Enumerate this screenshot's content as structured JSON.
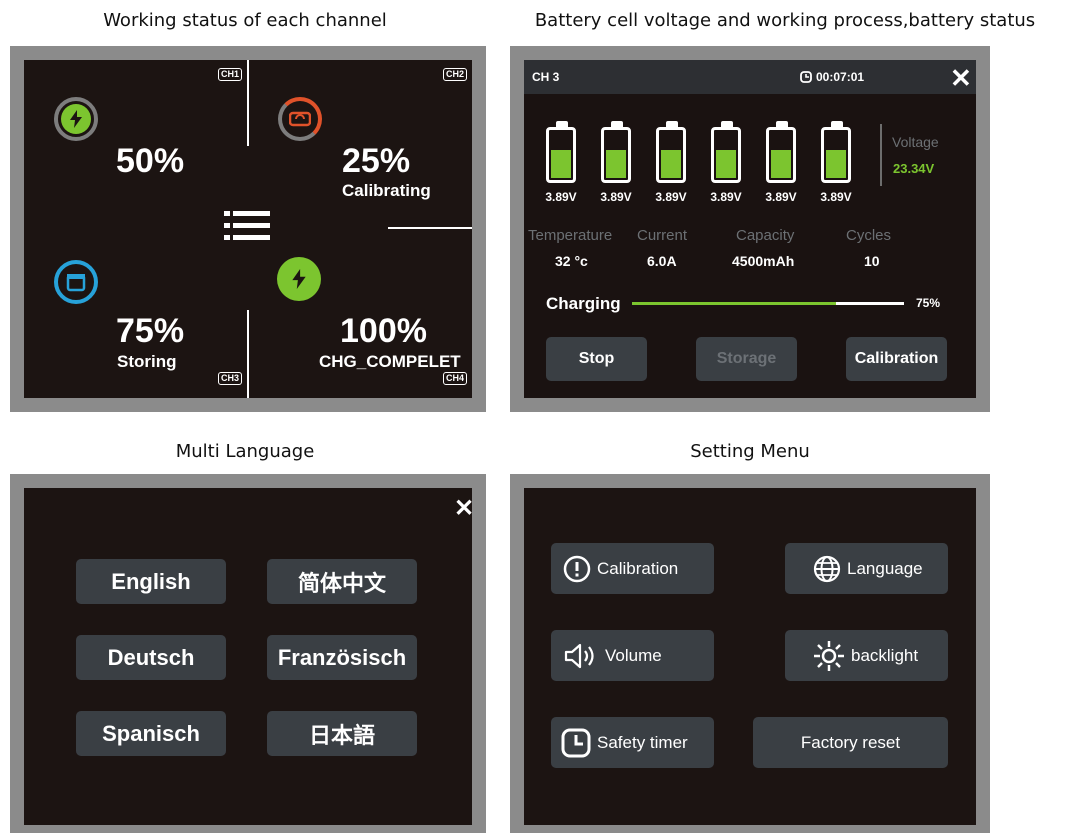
{
  "captions": {
    "channels": "Working status of each channel",
    "battery": "Battery cell voltage and working process,battery status",
    "language": "Multi Language",
    "settings": "Setting Menu"
  },
  "channels_screen": {
    "ch1": {
      "tag": "CH1",
      "percent": "50%",
      "status": "",
      "color": "#7cc52f"
    },
    "ch2": {
      "tag": "CH2",
      "percent": "25%",
      "status": "Calibrating",
      "color": "#e0522a"
    },
    "ch3": {
      "tag": "CH3",
      "percent": "75%",
      "status": "Storing",
      "color": "#27a2d9"
    },
    "ch4": {
      "tag": "CH4",
      "percent": "100%",
      "status": "CHG_COMPELET",
      "color": "#7cc52f"
    }
  },
  "battery_screen": {
    "channel": "CH 3",
    "timer": "00:07:01",
    "cells": [
      {
        "voltage": "3.89V",
        "fill": 0.56
      },
      {
        "voltage": "3.89V",
        "fill": 0.56
      },
      {
        "voltage": "3.89V",
        "fill": 0.56
      },
      {
        "voltage": "3.89V",
        "fill": 0.56
      },
      {
        "voltage": "3.89V",
        "fill": 0.56
      },
      {
        "voltage": "3.89V",
        "fill": 0.56
      }
    ],
    "voltage_label": "Voltage",
    "voltage_value": "23.34V",
    "stats": {
      "temperature_label": "Temperature",
      "temperature_value": "32 °c",
      "current_label": "Current",
      "current_value": "6.0A",
      "capacity_label": "Capacity",
      "capacity_value": "4500mAh",
      "cycles_label": "Cycles",
      "cycles_value": "10"
    },
    "progress_label": "Charging",
    "progress_value": "75%",
    "progress_fraction": 0.75,
    "buttons": {
      "stop": "Stop",
      "storage": "Storage",
      "calibration": "Calibration"
    }
  },
  "language_screen": {
    "close": "✕",
    "languages": [
      "English",
      "简体中文",
      "Deutsch",
      "Französisch",
      "Spanisch",
      "日本語"
    ]
  },
  "settings_screen": {
    "calibration": "Calibration",
    "language": "Language",
    "volume": "Volume",
    "backlight": "backlight",
    "safety_timer": "Safety timer",
    "factory_reset": "Factory reset"
  },
  "colors": {
    "accent_green": "#7cc52f",
    "screen_bg": "#1c1412",
    "button_bg": "#3a3f44",
    "frame": "#8b8b8b"
  }
}
